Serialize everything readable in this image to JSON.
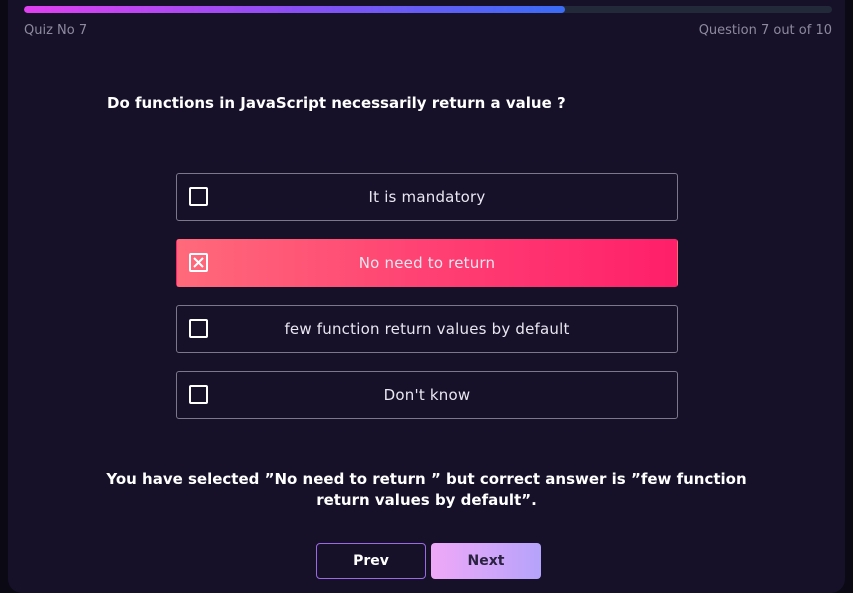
{
  "quiz": {
    "name": "Quiz No 7",
    "counter": "Question 7 out of 10",
    "progress_fraction": 0.67
  },
  "question": {
    "text": "Do functions in JavaScript necessarily return a value ?"
  },
  "options": [
    {
      "label": "It is mandatory",
      "selected": false
    },
    {
      "label": "No need to return",
      "selected": true
    },
    {
      "label": "few function return values by default",
      "selected": false
    },
    {
      "label": "Don't know",
      "selected": false
    }
  ],
  "feedback": {
    "line1": "You have selected ”No need to return ” but correct answer is ”few function",
    "line2": "return values by default”."
  },
  "nav": {
    "prev_label": "Prev",
    "next_label": "Next"
  },
  "colors": {
    "selected_option": "#ff3d72",
    "progress_start": "#e040f0",
    "progress_end": "#3a6cf6"
  },
  "icons": {
    "checkbox": "checkbox-icon",
    "checked": "checkbox-x-icon"
  }
}
